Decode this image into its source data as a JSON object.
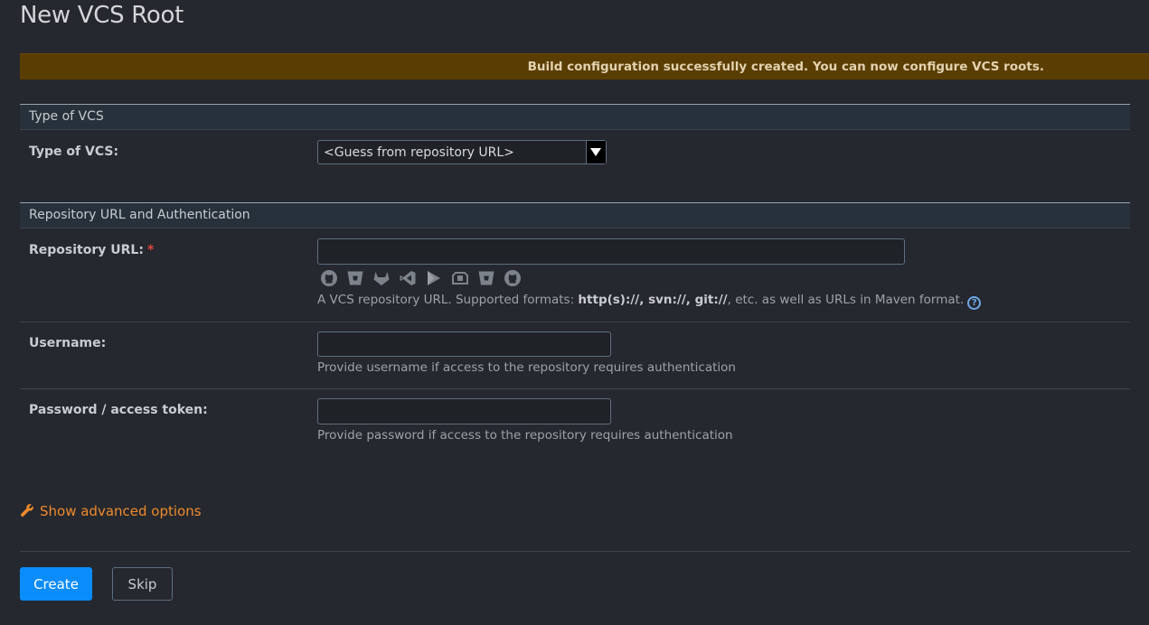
{
  "page": {
    "title": "New VCS Root"
  },
  "banner": {
    "message": "Build configuration successfully created. You can now configure VCS roots."
  },
  "sections": {
    "type_of_vcs": {
      "heading": "Type of VCS",
      "label": "Type of VCS:",
      "selected": "<Guess from repository URL>"
    },
    "repo_auth": {
      "heading": "Repository URL and Authentication"
    }
  },
  "repository_url": {
    "label": "Repository URL:",
    "required_mark": "*",
    "value": "",
    "hint_prefix": "A VCS repository URL. Supported formats: ",
    "hint_formats": "http(s)://, svn://, git://",
    "hint_suffix": ", etc. as well as URLs in Maven format.",
    "help_glyph": "?",
    "vcs_icons": [
      "github-icon",
      "bitbucket-icon",
      "gitlab-icon",
      "azure-devops-icon",
      "jetbrains-space-icon",
      "perforce-icon",
      "bitbucket-server-icon",
      "github-enterprise-icon"
    ]
  },
  "username": {
    "label": "Username:",
    "value": "",
    "hint": "Provide username if access to the repository requires authentication"
  },
  "password": {
    "label": "Password / access token:",
    "value": "",
    "hint": "Provide password if access to the repository requires authentication"
  },
  "advanced": {
    "label": "Show advanced options",
    "icon": "wrench-icon"
  },
  "actions": {
    "create_label": "Create",
    "skip_label": "Skip"
  },
  "colors": {
    "background": "#25282e",
    "banner": "#5a3d02",
    "primary": "#0a8cfa",
    "link": "#f08a2c",
    "required": "#e0453c"
  }
}
